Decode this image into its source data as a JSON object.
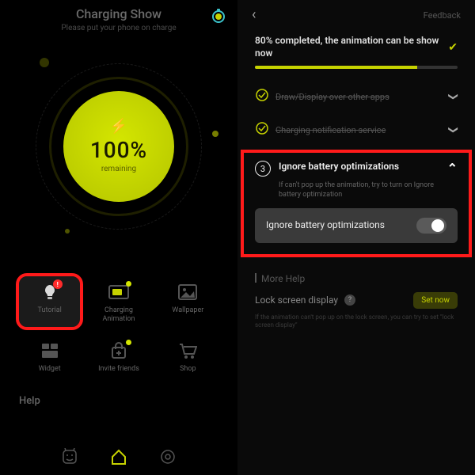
{
  "colors": {
    "accent": "#c6d200",
    "danger": "#ff1a1a"
  },
  "left": {
    "title": "Charging Show",
    "subtitle": "Please put your phone on charge",
    "battery": {
      "percent": "100%",
      "label": "remaining",
      "bolt": "⚡"
    },
    "grid": [
      {
        "id": "tutorial",
        "label": "Tutorial",
        "highlight": true
      },
      {
        "id": "charging-animation",
        "label": "Charging\nAnimation"
      },
      {
        "id": "wallpaper",
        "label": "Wallpaper"
      },
      {
        "id": "widget",
        "label": "Widget"
      },
      {
        "id": "invite-friends",
        "label": "Invite friends"
      },
      {
        "id": "shop",
        "label": "Shop"
      }
    ],
    "help_heading": "Help"
  },
  "right": {
    "feedback": "Feedback",
    "status": "80% completed, the animation can be show now",
    "progress_percent": 80,
    "steps": [
      {
        "label": "Draw/Display over other apps",
        "done": true
      },
      {
        "label": "Charging notification service",
        "done": true
      }
    ],
    "step3": {
      "number": "3",
      "title": "Ignore battery optimizations",
      "desc": "If can't pop up the animation, try to turn on Ignore battery optimization",
      "toggle_label": "Ignore battery optimizations",
      "toggle_on": true
    },
    "more_help": "More Help",
    "lock": {
      "label": "Lock screen display",
      "q": "?",
      "button": "Set now",
      "desc": "If the animation can't pop up on the lock screen, you can try to set \"lock screen display\""
    }
  }
}
